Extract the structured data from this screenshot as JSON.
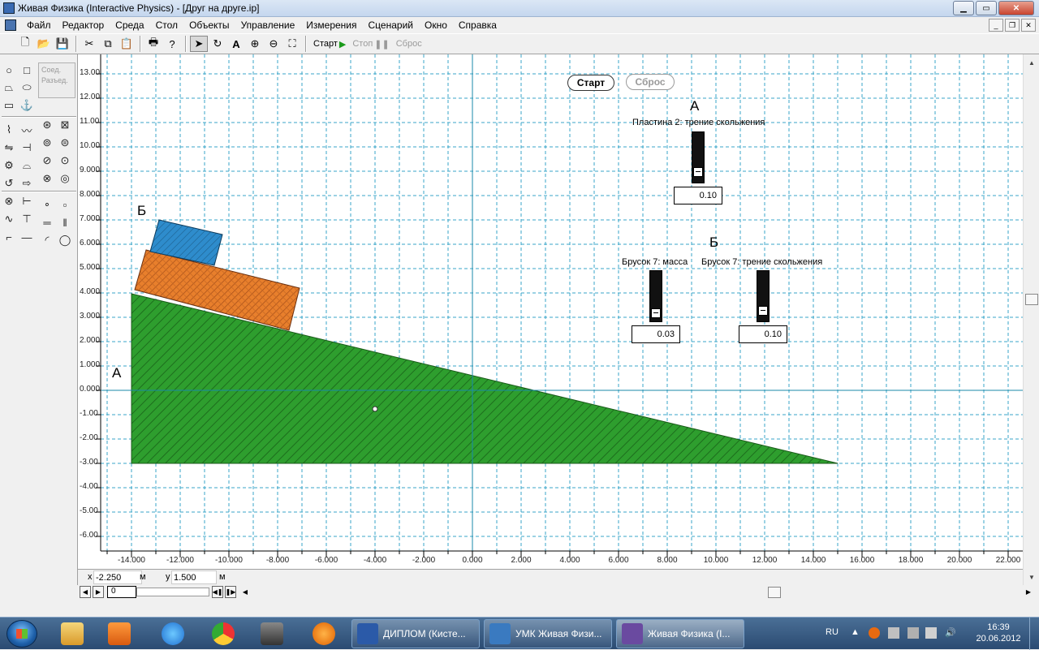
{
  "window": {
    "title": "Живая Физика (Interactive Physics) - [Друг на друге.ip]"
  },
  "menu": [
    "Файл",
    "Редактор",
    "Среда",
    "Стол",
    "Объекты",
    "Управление",
    "Измерения",
    "Сценарий",
    "Окно",
    "Справка"
  ],
  "toolbar": {
    "start": "Старт",
    "stop": "Стоп",
    "reset": "Сброс"
  },
  "palette": {
    "join": "Соед.",
    "split": "Разъед."
  },
  "workspace": {
    "start_button": "Старт",
    "reset_button": "Сброс",
    "label_a_panel": "А",
    "label_b_panel": "Б",
    "label_a_object": "А",
    "label_b_object": "Б",
    "y_ticks": [
      "13.00",
      "12.00",
      "11.00",
      "10.00",
      "9.000",
      "8.000",
      "7.000",
      "6.000",
      "5.000",
      "4.000",
      "3.000",
      "2.000",
      "1.000",
      "0.000",
      "-1.00",
      "-2.00",
      "-3.00",
      "-4.00",
      "-5.00",
      "-6.00"
    ],
    "x_ticks": [
      "-14.000",
      "-12.000",
      "-10.000",
      "-8.000",
      "-6.000",
      "-4.000",
      "-2.000",
      "0.000",
      "2.000",
      "4.000",
      "6.000",
      "8.000",
      "10.000",
      "12.000",
      "14.000",
      "16.000",
      "18.000",
      "20.000",
      "22.000"
    ],
    "sliders": [
      {
        "title": "Пластина 2: трение скольжения",
        "value": "0.10",
        "level": 0.1
      },
      {
        "title": "Брусок 7: масса",
        "value": "0.03",
        "level": 0.05
      },
      {
        "title": "Брусок 7: трение скольжения",
        "value": "0.10",
        "level": 0.1
      }
    ],
    "colors": {
      "ramp": "#2e9e2e",
      "block_orange": "#e87f2c",
      "block_blue": "#2e8ccc",
      "grid": "#3aa6c8"
    }
  },
  "coords": {
    "x_label": "x",
    "x_value": "-2.250",
    "x_unit": "м",
    "y_label": "y",
    "y_value": "1.500",
    "y_unit": "м"
  },
  "frame": {
    "value": "0"
  },
  "taskbar": {
    "tasks": [
      "ДИПЛОМ (Кисте...",
      "УМК Живая Физи...",
      "Живая Физика (I..."
    ],
    "lang": "RU",
    "time": "16:39",
    "date": "20.06.2012"
  }
}
